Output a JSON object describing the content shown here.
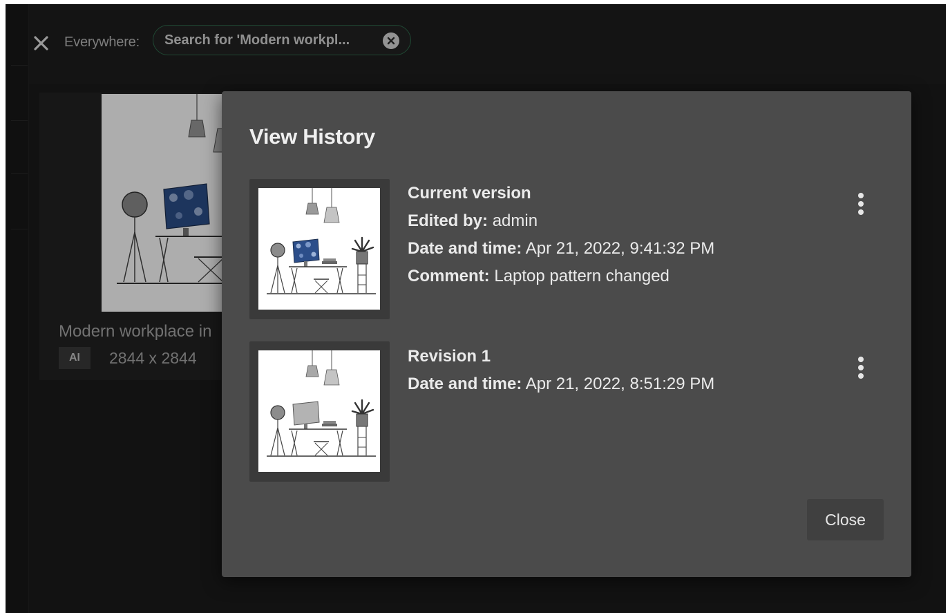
{
  "search": {
    "scope_label": "Everywhere:",
    "chip_text": "Search for 'Modern workpl..."
  },
  "asset_card": {
    "title": "Modern workplace in",
    "type_badge": "AI",
    "dimensions": "2844 x 2844"
  },
  "dialog": {
    "title": "View History",
    "versions": [
      {
        "heading": "Current version",
        "edited_by_label": "Edited by:",
        "edited_by_value": "admin",
        "date_label": "Date and time:",
        "date_value": "Apr 21, 2022, 9:41:32 PM",
        "comment_label": "Comment:",
        "comment_value": "Laptop pattern changed",
        "screen_style": "blue-pattern"
      },
      {
        "heading": "Revision 1",
        "date_label": "Date and time:",
        "date_value": "Apr 21, 2022, 8:51:29 PM",
        "screen_style": "plain-gray"
      }
    ],
    "close_label": "Close"
  },
  "colors": {
    "app_background": "#1b1b1b",
    "search_chip_border": "#2f6b4c",
    "dialog_background": "#4b4b4b",
    "thumbnail_frame": "#3a3a3a",
    "laptop_pattern_blue": "#2c4e8a",
    "close_button": "#404040"
  },
  "icons": {
    "clear_search": "close-x-icon",
    "remove_chip": "circle-x-icon",
    "version_menu": "more-vertical-icon"
  }
}
